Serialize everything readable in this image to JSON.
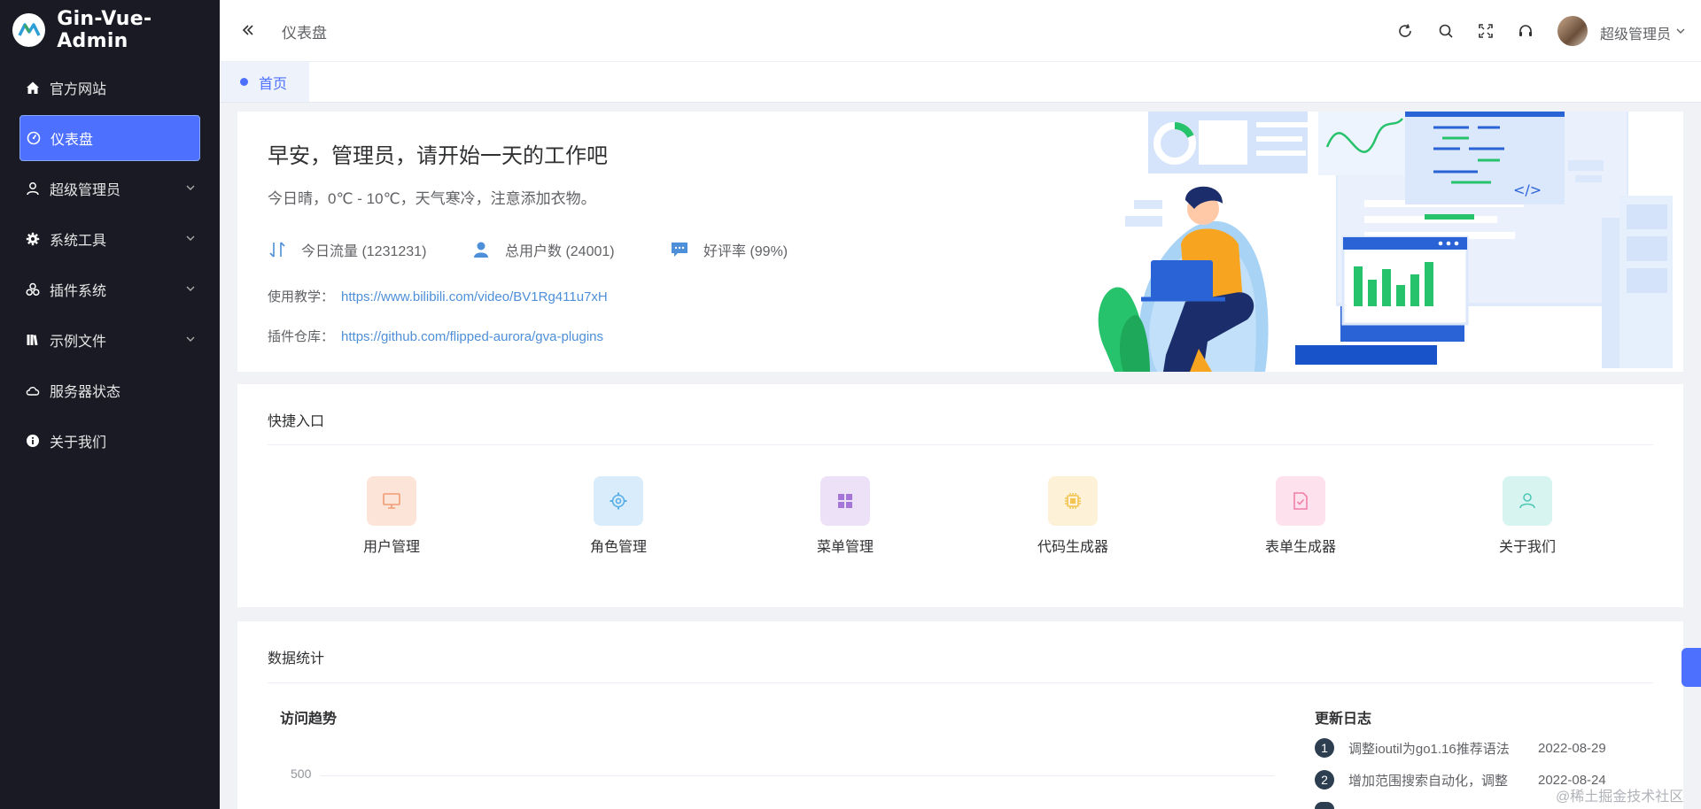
{
  "app": {
    "title": "Gin-Vue-Admin"
  },
  "sidebar": {
    "items": [
      {
        "label": "官方网站",
        "icon": "home-icon"
      },
      {
        "label": "仪表盘",
        "icon": "dashboard-icon",
        "active": true
      },
      {
        "label": "超级管理员",
        "icon": "user-icon",
        "expandable": true
      },
      {
        "label": "系统工具",
        "icon": "gear-icon",
        "expandable": true
      },
      {
        "label": "插件系统",
        "icon": "plugin-icon",
        "expandable": true
      },
      {
        "label": "示例文件",
        "icon": "folder-icon",
        "expandable": true
      },
      {
        "label": "服务器状态",
        "icon": "cloud-icon"
      },
      {
        "label": "关于我们",
        "icon": "info-icon"
      }
    ]
  },
  "header": {
    "breadcrumb": "仪表盘",
    "user_name": "超级管理员",
    "tools": [
      "refresh-icon",
      "search-icon",
      "fullscreen-icon",
      "headset-icon"
    ]
  },
  "tabs": [
    {
      "label": "首页",
      "active": true
    }
  ],
  "welcome": {
    "greeting": "早安，管理员，请开始一天的工作吧",
    "weather": "今日晴，0℃ - 10℃，天气寒冷，注意添加衣物。",
    "stats": [
      {
        "label": "今日流量 (1231231)",
        "icon": "traffic-icon"
      },
      {
        "label": "总用户数 (24001)",
        "icon": "users-icon"
      },
      {
        "label": "好评率 (99%)",
        "icon": "comment-icon"
      }
    ],
    "tutorial_label": "使用教学：",
    "tutorial_url": "https://www.bilibili.com/video/BV1Rg411u7xH",
    "plugin_label": "插件仓库：",
    "plugin_url": "https://github.com/flipped-aurora/gva-plugins"
  },
  "quick": {
    "title": "快捷入口",
    "items": [
      {
        "label": "用户管理",
        "icon": "monitor-icon",
        "bg": "#fde4d8",
        "fg": "#f19b73"
      },
      {
        "label": "角色管理",
        "icon": "gear-icon",
        "bg": "#d8ecfb",
        "fg": "#5aaee8"
      },
      {
        "label": "菜单管理",
        "icon": "grid-icon",
        "bg": "#ece1f6",
        "fg": "#a675d8"
      },
      {
        "label": "代码生成器",
        "icon": "chip-icon",
        "bg": "#fdf1d7",
        "fg": "#f3c450"
      },
      {
        "label": "表单生成器",
        "icon": "document-icon",
        "bg": "#fde1ec",
        "fg": "#ef7eaa"
      },
      {
        "label": "关于我们",
        "icon": "user-icon",
        "bg": "#d8f4f0",
        "fg": "#4ec7b5"
      }
    ]
  },
  "stats": {
    "title": "数据统计",
    "trend_title": "访问趋势",
    "y_tick": "500",
    "log_title": "更新日志",
    "logs": [
      {
        "num": "1",
        "text": "调整ioutil为go1.16推荐语法",
        "date": "2022-08-29"
      },
      {
        "num": "2",
        "text": "增加范围搜索自动化，调整",
        "date": "2022-08-24"
      }
    ]
  },
  "watermark": "@稀土掘金技术社区"
}
